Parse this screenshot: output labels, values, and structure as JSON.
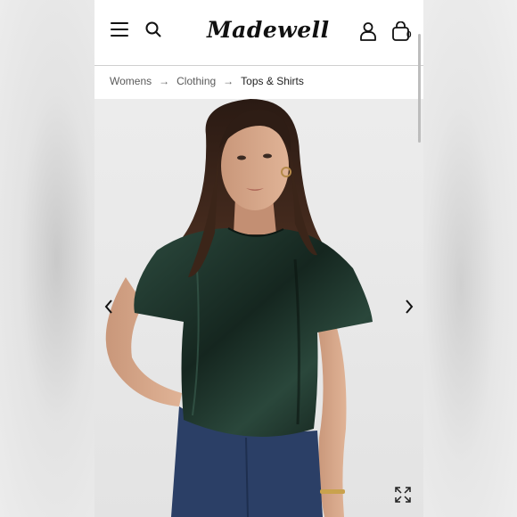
{
  "brand": {
    "logo_text": "Madewell"
  },
  "header": {
    "bag_count": "0"
  },
  "breadcrumb": {
    "items": [
      "Womens",
      "Clothing",
      "Tops & Shirts"
    ],
    "separator": "→"
  },
  "product_image": {
    "description_icon": "model-wearing-green-velvet-top"
  },
  "colors": {
    "top_green": "#1f3a30",
    "jeans_blue": "#2b3f66",
    "text_dark": "#111111"
  }
}
